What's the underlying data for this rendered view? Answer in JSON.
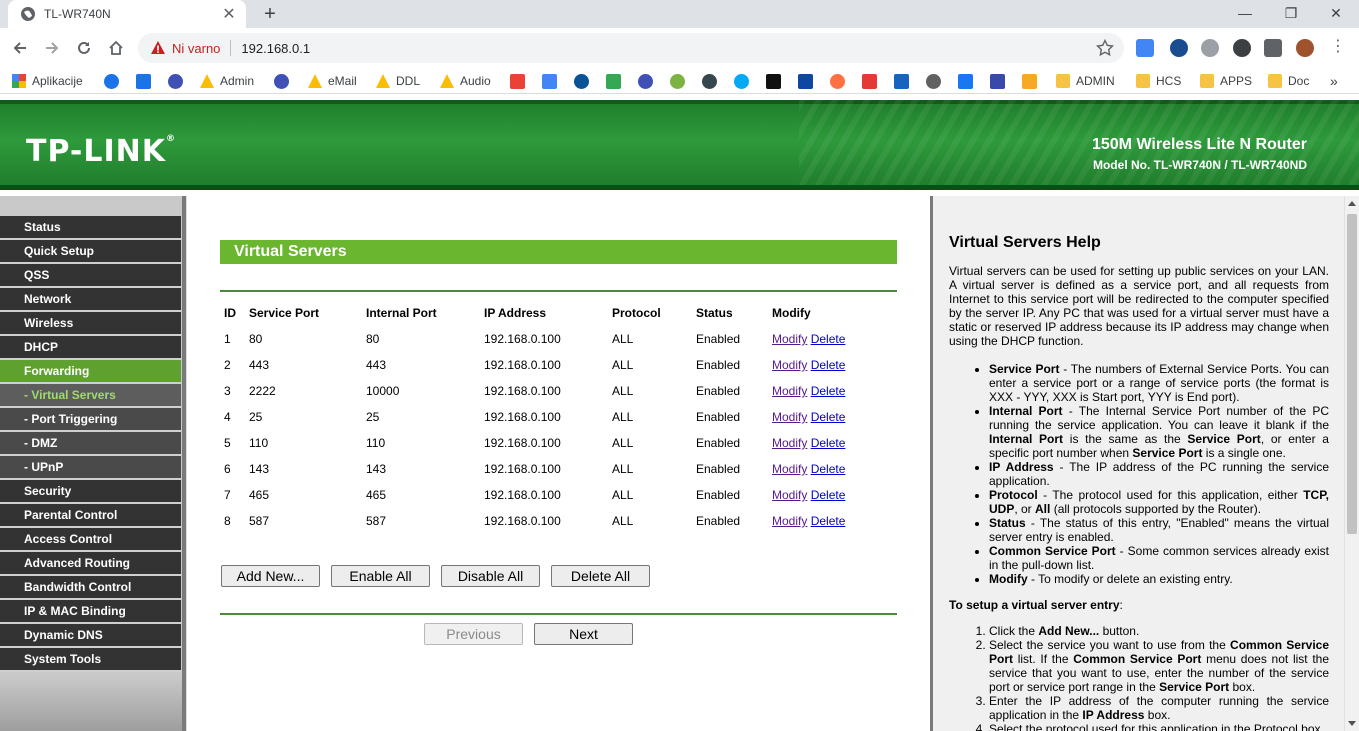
{
  "browser": {
    "tab_title": "TL-WR740N",
    "tab_close": "✕",
    "new_tab": "+",
    "security_label": "Ni varno",
    "url": "192.168.0.1",
    "win_minimize": "—",
    "win_restore": "❐",
    "win_close": "✕",
    "bookmarks_overflow": "»"
  },
  "bookmarks": [
    {
      "label": "Aplikacije"
    },
    {
      "label": "Admin"
    },
    {
      "label": "eMail"
    },
    {
      "label": "DDL"
    },
    {
      "label": "Audio"
    },
    {
      "label": "ADMIN"
    },
    {
      "label": "HCS"
    },
    {
      "label": "APPS"
    },
    {
      "label": "Doc"
    }
  ],
  "router": {
    "brand": "TP-LINK",
    "brand_reg": "®",
    "model_title": "150M Wireless Lite N Router",
    "model_no": "Model No. TL-WR740N / TL-WR740ND"
  },
  "menu": [
    {
      "label": "Status"
    },
    {
      "label": "Quick Setup"
    },
    {
      "label": "QSS"
    },
    {
      "label": "Network"
    },
    {
      "label": "Wireless"
    },
    {
      "label": "DHCP"
    },
    {
      "label": "Forwarding"
    },
    {
      "label": "- Virtual Servers"
    },
    {
      "label": "- Port Triggering"
    },
    {
      "label": "- DMZ"
    },
    {
      "label": "- UPnP"
    },
    {
      "label": "Security"
    },
    {
      "label": "Parental Control"
    },
    {
      "label": "Access Control"
    },
    {
      "label": "Advanced Routing"
    },
    {
      "label": "Bandwidth Control"
    },
    {
      "label": "IP & MAC Binding"
    },
    {
      "label": "Dynamic DNS"
    },
    {
      "label": "System Tools"
    }
  ],
  "main": {
    "title": "Virtual Servers",
    "columns": [
      "ID",
      "Service Port",
      "Internal Port",
      "IP Address",
      "Protocol",
      "Status",
      "Modify"
    ],
    "rows": [
      {
        "id": "1",
        "service_port": "80",
        "internal_port": "80",
        "ip": "192.168.0.100",
        "protocol": "ALL",
        "status": "Enabled"
      },
      {
        "id": "2",
        "service_port": "443",
        "internal_port": "443",
        "ip": "192.168.0.100",
        "protocol": "ALL",
        "status": "Enabled"
      },
      {
        "id": "3",
        "service_port": "2222",
        "internal_port": "10000",
        "ip": "192.168.0.100",
        "protocol": "ALL",
        "status": "Enabled"
      },
      {
        "id": "4",
        "service_port": "25",
        "internal_port": "25",
        "ip": "192.168.0.100",
        "protocol": "ALL",
        "status": "Enabled"
      },
      {
        "id": "5",
        "service_port": "110",
        "internal_port": "110",
        "ip": "192.168.0.100",
        "protocol": "ALL",
        "status": "Enabled"
      },
      {
        "id": "6",
        "service_port": "143",
        "internal_port": "143",
        "ip": "192.168.0.100",
        "protocol": "ALL",
        "status": "Enabled"
      },
      {
        "id": "7",
        "service_port": "465",
        "internal_port": "465",
        "ip": "192.168.0.100",
        "protocol": "ALL",
        "status": "Enabled"
      },
      {
        "id": "8",
        "service_port": "587",
        "internal_port": "587",
        "ip": "192.168.0.100",
        "protocol": "ALL",
        "status": "Enabled"
      }
    ],
    "modify_label": "Modify",
    "delete_label": "Delete",
    "add_new": "Add New...",
    "enable_all": "Enable All",
    "disable_all": "Disable All",
    "delete_all": "Delete All",
    "previous": "Previous",
    "next": "Next"
  },
  "help": {
    "title": "Virtual Servers Help",
    "intro": "Virtual servers can be used for setting up public services on your LAN. A virtual server is defined as a service port, and all requests from Internet to this service port will be redirected to the computer specified by the server IP. Any PC that was used for a virtual server must have a static or reserved IP address because its IP address may change when using the DHCP function.",
    "sp_term": "Service Port",
    "sp_text": " - The numbers of External Service Ports. You can enter a service port or a range of service ports (the format is XXX - YYY, XXX is Start port, YYY is End port).",
    "ip_term": "Internal Port",
    "ip_text1": " - The Internal Service Port number of the PC running the service application. You can leave it blank if the ",
    "ip_term2": "Internal Port",
    "ip_text2": " is the same as the ",
    "ip_term3": "Service Port",
    "ip_text3": ", or enter a specific port number when ",
    "ip_term4": "Service Port",
    "ip_text4": " is a single one.",
    "addr_term": "IP Address",
    "addr_text": " - The IP address of the PC running the service application.",
    "proto_term": "Protocol",
    "proto_text1": " - The protocol used for this application, either ",
    "proto_tcp": "TCP,",
    "proto_udp": "UDP",
    "proto_text2": ", or ",
    "proto_all": "All",
    "proto_text3": " (all protocols supported by the Router).",
    "status_term": "Status",
    "status_text": " - The status of this entry, \"Enabled\" means the virtual server entry is enabled.",
    "csp_term": "Common Service Port",
    "csp_text": " - Some common services already exist in the pull-down list.",
    "mod_term": "Modify",
    "mod_text": " - To modify or delete an existing entry.",
    "setup_title": "To setup a virtual server entry",
    "setup_colon": ":",
    "step1_a": "Click the ",
    "step1_b": "Add New...",
    "step1_c": " button.",
    "step2_a": "Select the service you want to use from the ",
    "step2_b": "Common Service Port",
    "step2_c": " list. If the ",
    "step2_d": "Common Service Port",
    "step2_e": " menu does not list the service that you want to use, enter the number of the service port or service port range in the ",
    "step2_f": "Service Port",
    "step2_g": " box.",
    "step3_a": "Enter the IP address of the computer running the service application in the ",
    "step3_b": "IP Address",
    "step3_c": " box.",
    "step4_a": "Select the protocol used for this application in the Protocol box."
  }
}
